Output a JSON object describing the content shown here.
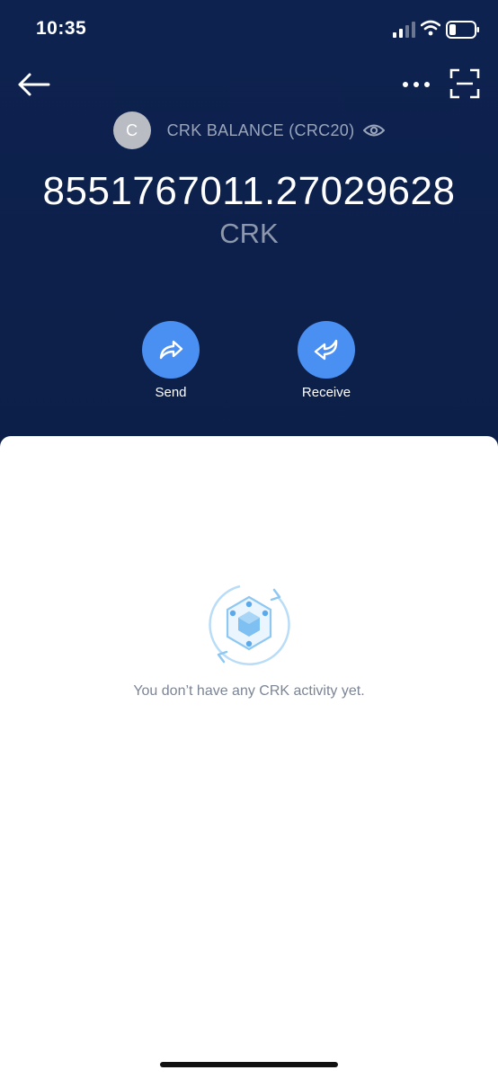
{
  "status_bar": {
    "time": "10:35"
  },
  "token": {
    "avatar_letter": "C",
    "balance_label": "CRK BALANCE (CRC20)",
    "balance": "8551767011.27029628",
    "unit": "CRK"
  },
  "actions": {
    "send_label": "Send",
    "receive_label": "Receive"
  },
  "activity": {
    "empty_message": "You don’t have any CRK activity yet."
  },
  "icons": {
    "back": "arrow-left-icon",
    "more": "more-horizontal-icon",
    "scan": "scan-icon",
    "eye": "eye-icon",
    "send": "share-arrow-icon",
    "receive": "return-arrow-icon",
    "empty": "cube-refresh-icon"
  },
  "colors": {
    "header_bg": "#0e2250",
    "accent": "#4a8ff2",
    "muted_text": "#9aa5bb"
  }
}
